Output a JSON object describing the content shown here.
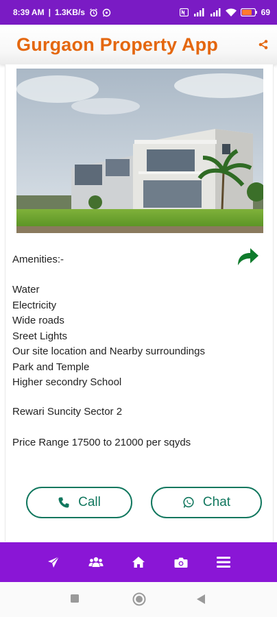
{
  "status_bar": {
    "time": "8:39 AM",
    "speed": "1.3KB/s",
    "battery": "69"
  },
  "app_bar": {
    "title": "Gurgaon Property App",
    "share_icon": "share-icon"
  },
  "property": {
    "image_icon": "house-photo",
    "amenities_title": "Amenities:-",
    "amenities": [
      "Water",
      "Electricity",
      "Wide roads",
      "Sreet Lights",
      "Our site location and Nearby surroundings",
      "Park and Temple",
      "Higher secondry School"
    ],
    "location": "Rewari Suncity Sector 2",
    "price": "Price Range 17500 to 21000 per sqyds"
  },
  "actions": {
    "call_label": "Call",
    "chat_label": "Chat"
  },
  "bottom_nav": {
    "items": [
      "send-icon",
      "group-icon",
      "home-icon",
      "camera-icon",
      "menu-icon"
    ]
  },
  "colors": {
    "status_bar": "#7a1bc4",
    "title": "#e4670f",
    "accent_green": "#11775e",
    "bottom_nav": "#8a16d6"
  }
}
